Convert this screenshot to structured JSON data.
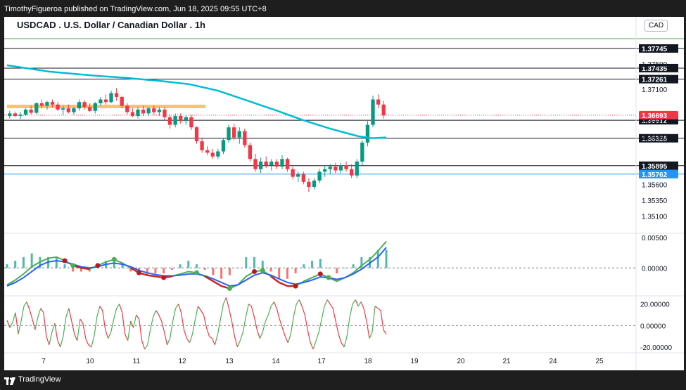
{
  "header": {
    "publisher": "TimothyFigueroa published on TradingView.com, Jun 18, 2025 09:55 UTC+8"
  },
  "footer": {
    "brand": "TradingView"
  },
  "chart_data": {
    "type": "candlestick",
    "title": "USDCAD . U.S. Dollar / Canadian Dollar . 1h",
    "currency": "CAD",
    "ylim": [
      1.3485,
      1.38
    ],
    "price_ticks": [
      "1.37500",
      "1.37100",
      "1.36600",
      "1.36350",
      "1.35600",
      "1.35350",
      "1.35100"
    ],
    "price_tick_values": [
      1.375,
      1.371,
      1.366,
      1.3635,
      1.356,
      1.3535,
      1.351
    ],
    "x_ticks": [
      "7",
      "10",
      "11",
      "12",
      "13",
      "14",
      "17",
      "18",
      "19",
      "20",
      "21",
      "24",
      "25"
    ],
    "levels": [
      {
        "label": "1.37745",
        "value": 1.37745,
        "color": "#131722"
      },
      {
        "label": "1.37435",
        "value": 1.37435,
        "color": "#131722"
      },
      {
        "label": "1.37261",
        "value": 1.37261,
        "color": "#131722"
      },
      {
        "label": "1.36612",
        "value": 1.36612,
        "color": "#131722"
      },
      {
        "label": "1.36328",
        "value": 1.36328,
        "color": "#131722"
      },
      {
        "label": "1.35895",
        "value": 1.35895,
        "color": "#131722"
      },
      {
        "label": "1.35762",
        "value": 1.35762,
        "color": "#2196f3"
      }
    ],
    "top_level": {
      "value": 1.379,
      "color": "#4caf50"
    },
    "current_price": {
      "label": "1.36693",
      "value": 1.36693,
      "color": "#f23645"
    },
    "resistance_zone": {
      "value": 1.3683,
      "color": "#ffb74d"
    },
    "moving_average": {
      "color": "#00bcd4",
      "points": [
        [
          0,
          1.3748
        ],
        [
          60,
          1.3738
        ],
        [
          120,
          1.3732
        ],
        [
          170,
          1.3728
        ],
        [
          220,
          1.3723
        ],
        [
          260,
          1.3718
        ],
        [
          300,
          1.3708
        ],
        [
          340,
          1.3693
        ],
        [
          380,
          1.3678
        ],
        [
          420,
          1.3662
        ],
        [
          460,
          1.3648
        ],
        [
          500,
          1.3636
        ],
        [
          520,
          1.3633
        ],
        [
          540,
          1.3634
        ]
      ]
    },
    "candles": [
      [
        1.3668,
        1.3676,
        1.3664,
        1.3672
      ],
      [
        1.3672,
        1.3675,
        1.3666,
        1.3668
      ],
      [
        1.3668,
        1.3674,
        1.3663,
        1.367
      ],
      [
        1.367,
        1.368,
        1.3668,
        1.3678
      ],
      [
        1.3678,
        1.3684,
        1.367,
        1.3673
      ],
      [
        1.3673,
        1.369,
        1.3671,
        1.3688
      ],
      [
        1.3688,
        1.3694,
        1.368,
        1.3684
      ],
      [
        1.3684,
        1.3692,
        1.3678,
        1.369
      ],
      [
        1.369,
        1.3694,
        1.3682,
        1.3686
      ],
      [
        1.3686,
        1.369,
        1.3676,
        1.3678
      ],
      [
        1.3678,
        1.3684,
        1.367,
        1.368
      ],
      [
        1.368,
        1.3686,
        1.3672,
        1.3674
      ],
      [
        1.3674,
        1.3682,
        1.367,
        1.368
      ],
      [
        1.368,
        1.3694,
        1.3676,
        1.369
      ],
      [
        1.369,
        1.3693,
        1.3678,
        1.3682
      ],
      [
        1.3682,
        1.3688,
        1.3674,
        1.3676
      ],
      [
        1.3676,
        1.369,
        1.3672,
        1.3688
      ],
      [
        1.3688,
        1.3698,
        1.3684,
        1.3694
      ],
      [
        1.3694,
        1.3702,
        1.3686,
        1.369
      ],
      [
        1.369,
        1.3708,
        1.3688,
        1.3704
      ],
      [
        1.3704,
        1.3712,
        1.3692,
        1.3698
      ],
      [
        1.3698,
        1.37,
        1.368,
        1.3684
      ],
      [
        1.3684,
        1.3688,
        1.367,
        1.3674
      ],
      [
        1.3674,
        1.368,
        1.3666,
        1.3668
      ],
      [
        1.3668,
        1.3682,
        1.3664,
        1.3678
      ],
      [
        1.3678,
        1.3684,
        1.3668,
        1.3672
      ],
      [
        1.3672,
        1.3682,
        1.3668,
        1.368
      ],
      [
        1.368,
        1.3684,
        1.367,
        1.3674
      ],
      [
        1.3674,
        1.3682,
        1.3668,
        1.3678
      ],
      [
        1.3678,
        1.3682,
        1.3662,
        1.3666
      ],
      [
        1.3666,
        1.367,
        1.3648,
        1.3654
      ],
      [
        1.3654,
        1.3672,
        1.365,
        1.3668
      ],
      [
        1.3668,
        1.3672,
        1.3656,
        1.366
      ],
      [
        1.366,
        1.367,
        1.3654,
        1.3666
      ],
      [
        1.3666,
        1.367,
        1.3646,
        1.365
      ],
      [
        1.365,
        1.3652,
        1.3624,
        1.3628
      ],
      [
        1.3628,
        1.3634,
        1.361,
        1.3614
      ],
      [
        1.3614,
        1.362,
        1.3606,
        1.361
      ],
      [
        1.361,
        1.3616,
        1.36,
        1.3604
      ],
      [
        1.3604,
        1.3616,
        1.36,
        1.3612
      ],
      [
        1.3612,
        1.3632,
        1.3608,
        1.363
      ],
      [
        1.363,
        1.3654,
        1.3626,
        1.365
      ],
      [
        1.365,
        1.3656,
        1.363,
        1.3634
      ],
      [
        1.3634,
        1.365,
        1.3624,
        1.3644
      ],
      [
        1.3644,
        1.3648,
        1.3618,
        1.3622
      ],
      [
        1.3622,
        1.3626,
        1.3596,
        1.36
      ],
      [
        1.36,
        1.3608,
        1.358,
        1.3584
      ],
      [
        1.3584,
        1.3602,
        1.3578,
        1.3596
      ],
      [
        1.3596,
        1.3604,
        1.3586,
        1.359
      ],
      [
        1.359,
        1.36,
        1.3582,
        1.3596
      ],
      [
        1.3596,
        1.36,
        1.3584,
        1.3588
      ],
      [
        1.3588,
        1.3606,
        1.3584,
        1.36
      ],
      [
        1.36,
        1.3602,
        1.358,
        1.3584
      ],
      [
        1.3584,
        1.3588,
        1.3568,
        1.3572
      ],
      [
        1.3572,
        1.358,
        1.3564,
        1.3576
      ],
      [
        1.3576,
        1.358,
        1.356,
        1.3564
      ],
      [
        1.3564,
        1.357,
        1.3548,
        1.3556
      ],
      [
        1.3556,
        1.357,
        1.3552,
        1.3566
      ],
      [
        1.3566,
        1.3584,
        1.3562,
        1.358
      ],
      [
        1.358,
        1.359,
        1.3572,
        1.3584
      ],
      [
        1.3584,
        1.3592,
        1.3576,
        1.3588
      ],
      [
        1.3588,
        1.3594,
        1.3578,
        1.3582
      ],
      [
        1.3582,
        1.3594,
        1.3578,
        1.359
      ],
      [
        1.359,
        1.3596,
        1.358,
        1.3584
      ],
      [
        1.3584,
        1.3592,
        1.357,
        1.3574
      ],
      [
        1.3574,
        1.36,
        1.357,
        1.3596
      ],
      [
        1.3596,
        1.363,
        1.359,
        1.3626
      ],
      [
        1.3626,
        1.366,
        1.362,
        1.3654
      ],
      [
        1.3654,
        1.37,
        1.365,
        1.3694
      ],
      [
        1.3694,
        1.3702,
        1.368,
        1.3686
      ],
      [
        1.3686,
        1.3692,
        1.3664,
        1.3669
      ]
    ],
    "macd": {
      "zero_label": "0.00000",
      "top_label": "0.00500",
      "ylim": [
        -0.0045,
        0.0055
      ],
      "macd_color": "#4caf50",
      "signal_color": "#2962ff",
      "macd": [
        -0.0028,
        -0.002,
        -0.001,
        0.0002,
        0.001,
        0.0016,
        0.0018,
        0.0012,
        0.0004,
        0.0,
        -0.0002,
        0.0004,
        0.001,
        0.0014,
        0.0008,
        0.0,
        -0.0008,
        -0.0012,
        -0.0014,
        -0.0016,
        -0.0014,
        -0.001,
        -0.0006,
        -0.0008,
        -0.0014,
        -0.0022,
        -0.003,
        -0.0034,
        -0.0028,
        -0.0014,
        -0.0006,
        -0.0004,
        -0.0014,
        -0.0024,
        -0.003,
        -0.003,
        -0.0022,
        -0.0016,
        -0.001,
        -0.0016,
        -0.0022,
        -0.0016,
        -0.0008,
        0.0004,
        0.0014,
        0.0028,
        0.0044
      ],
      "signal": [
        -0.003,
        -0.0024,
        -0.0016,
        -0.0006,
        0.0004,
        0.001,
        0.0012,
        0.001,
        0.0006,
        0.0002,
        0.0,
        0.0002,
        0.0006,
        0.0008,
        0.0006,
        0.0002,
        -0.0004,
        -0.0008,
        -0.0011,
        -0.0013,
        -0.0013,
        -0.0012,
        -0.001,
        -0.001,
        -0.0013,
        -0.0018,
        -0.0024,
        -0.003,
        -0.0028,
        -0.002,
        -0.0012,
        -0.0008,
        -0.0012,
        -0.0018,
        -0.0024,
        -0.0027,
        -0.0024,
        -0.002,
        -0.0015,
        -0.0016,
        -0.0019,
        -0.0016,
        -0.001,
        -0.0002,
        0.0008,
        0.0018,
        0.0034
      ],
      "markers_green": [
        8,
        13,
        23,
        27,
        31,
        39
      ],
      "markers_red": [
        7,
        11,
        16,
        19,
        30,
        35,
        38
      ]
    },
    "oscillator": {
      "labels": [
        "20.00000",
        "0.00000",
        "-20.00000"
      ],
      "label_values": [
        20,
        0,
        -20
      ],
      "ylim": [
        -24,
        27
      ],
      "up_color": "#4caf50",
      "down_color": "#f23645",
      "values": [
        5,
        -2,
        3,
        12,
        -8,
        4,
        18,
        22,
        15,
        6,
        -4,
        8,
        16,
        12,
        -10,
        -18,
        -6,
        2,
        -14,
        -20,
        -10,
        8,
        16,
        4,
        -8,
        -14,
        6,
        2,
        -12,
        -18,
        -20,
        -10,
        8,
        18,
        14,
        -4,
        -12,
        -6,
        6,
        16,
        20,
        12,
        -8,
        -14,
        4,
        -2,
        10,
        6,
        -14,
        -22,
        -18,
        -4,
        8,
        14,
        10,
        4,
        -6,
        -18,
        -12,
        4,
        16,
        20,
        12,
        -4,
        -12,
        -16,
        -8,
        6,
        18,
        14,
        10,
        -2,
        -10,
        -12,
        -18,
        -8,
        6,
        20,
        26,
        16,
        4,
        -10,
        -20,
        -14,
        -6,
        8,
        20,
        18,
        8,
        -4,
        -12,
        -6,
        4,
        10,
        18,
        22,
        16,
        6,
        -2,
        -10,
        -16,
        -8,
        8,
        20,
        24,
        18,
        10,
        -4,
        -16,
        -22,
        -14,
        -6,
        6,
        18,
        24,
        20,
        16,
        4,
        -8,
        -16,
        -20,
        -10,
        8,
        20,
        24,
        18,
        22,
        16,
        4,
        -12,
        -6,
        18,
        16,
        14,
        -4,
        -8
      ]
    }
  }
}
